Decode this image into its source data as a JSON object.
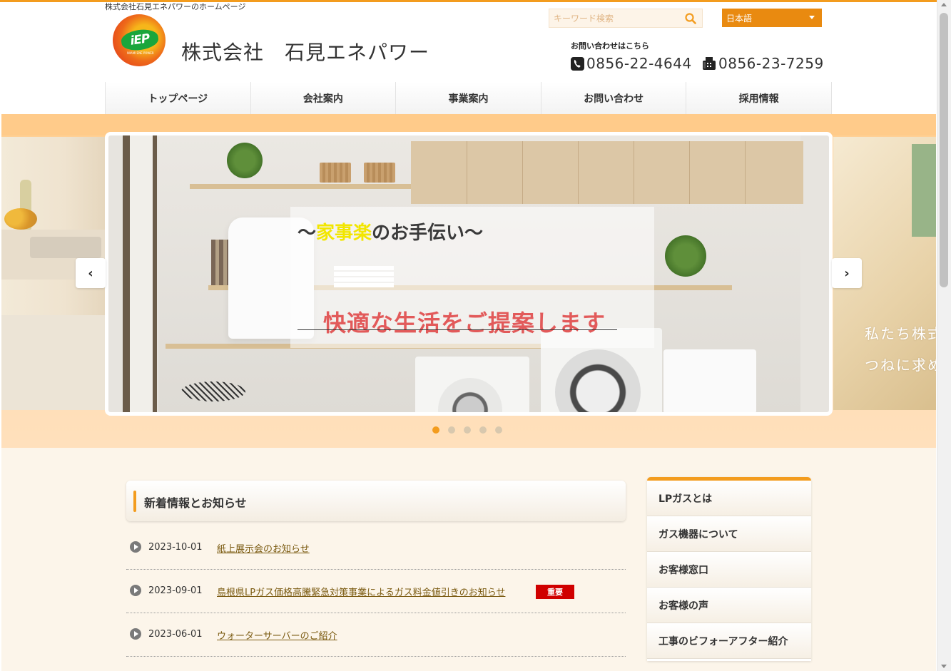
{
  "header": {
    "tagline": "株式会社石見エネパワーのホームページ",
    "logo_text": "iEP",
    "logo_sub": "IWAMI ENE POWER",
    "company_name": "株式会社　石見エネパワー"
  },
  "search": {
    "placeholder": "キーワード検索"
  },
  "language": {
    "selected": "日本語"
  },
  "contact": {
    "label": "お問い合わせはこちら",
    "tel": "0856-22-4644",
    "fax": "0856-23-7259"
  },
  "nav": {
    "items": [
      "トップページ",
      "会社案内",
      "事業案内",
      "お問い合わせ",
      "採用情報"
    ]
  },
  "slider": {
    "caption_prefix": "〜",
    "caption_highlight": "家事楽",
    "caption_suffix": "のお手伝い〜",
    "caption_main": "快適な生活をご提案します",
    "next_slide_text_line1": "私たち株式",
    "next_slide_text_line2": "つねに求め",
    "prev_label": "‹",
    "next_label": "›",
    "dot_count": 5,
    "active_dot": 0
  },
  "news": {
    "title": "新着情報とお知らせ",
    "items": [
      {
        "date": "2023-10-01",
        "title": "紙上展示会のお知らせ",
        "badge": ""
      },
      {
        "date": "2023-09-01",
        "title": "島根県LPガス価格高騰緊急対策事業によるガス料金値引きのお知らせ",
        "badge": "重要"
      },
      {
        "date": "2023-06-01",
        "title": "ウォーターサーバーのご紹介",
        "badge": ""
      }
    ]
  },
  "sidebar": {
    "items": [
      "LPガスとは",
      "ガス機器について",
      "お客様窓口",
      "お客様の声",
      "工事のビフォーアフター紹介"
    ]
  },
  "colors": {
    "accent": "#f39c1e",
    "band": "#ffcb8a",
    "important": "#d00000",
    "highlight": "#f2e600",
    "caption_red": "#e25a5a"
  }
}
